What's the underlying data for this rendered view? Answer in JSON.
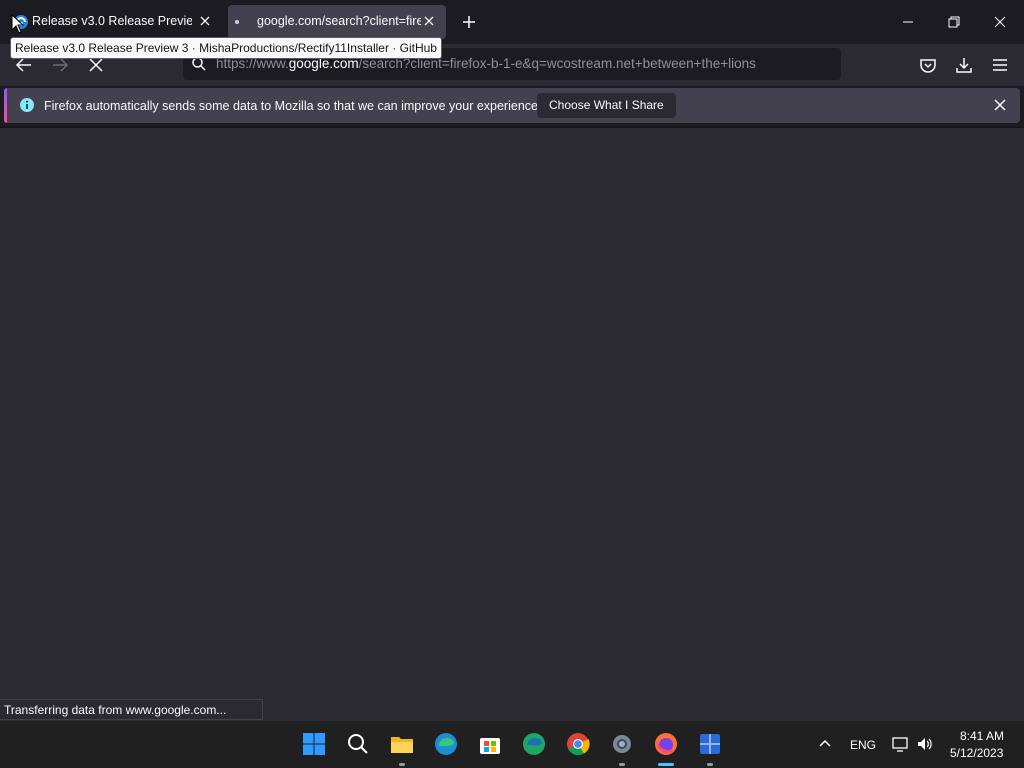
{
  "tabs": [
    {
      "title": "Release v3.0 Release Preview 3 · MishaProductions/Rectify11Installer · GitHub",
      "short_title": "Release v3.0 Release Preview 3",
      "active": false
    },
    {
      "title": "google.com/search?client=firefox-b-1-e&q=wcostream.net+between+the+lions",
      "short_title": "google.com/search?client=firef",
      "active": true,
      "loading": true
    }
  ],
  "tooltip": "Release v3.0 Release Preview 3 · MishaProductions/Rectify11Installer · GitHub",
  "urlbar": {
    "prefix": "https://www.",
    "host": "google.com",
    "path": "/search?client=firefox-b-1-e&q=wcostream.net+between+the+lions"
  },
  "notification": {
    "message": "Firefox automatically sends some data to Mozilla so that we can improve your experience.",
    "button_label": "Choose What I Share"
  },
  "status": "Transferring data from www.google.com...",
  "taskbar": {
    "apps": [
      "start",
      "search",
      "file-explorer",
      "edge",
      "microsoft-store",
      "edge-beta",
      "chrome",
      "settings",
      "firefox",
      "rectify11-installer"
    ],
    "active_app": "firefox",
    "language": "ENG",
    "time": "8:41 AM",
    "date": "5/12/2023"
  },
  "colors": {
    "tab_active": "#42414d",
    "accent": "#4cc2ff",
    "background": "#1c1b22",
    "toolbar": "#2b2a33"
  }
}
